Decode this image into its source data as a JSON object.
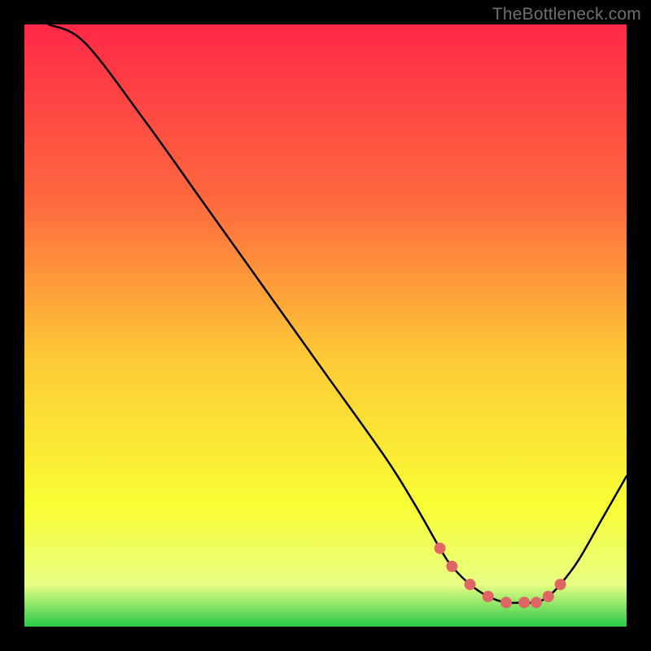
{
  "watermark": "TheBottleneck.com",
  "colors": {
    "gradient_top": "#fe2947",
    "gradient_upper_mid": "#fe6b3e",
    "gradient_mid": "#fdc936",
    "gradient_low": "#f8fe34",
    "gradient_base": "#e8fe83",
    "gradient_green": "#29ca49",
    "curve_stroke": "#000000",
    "dot_fill": "#e06666",
    "frame": "#000000",
    "watermark": "#6f6f6f"
  },
  "chart_data": {
    "type": "line",
    "title": "",
    "xlabel": "",
    "ylabel": "",
    "xlim": [
      0,
      100
    ],
    "ylim": [
      0,
      100
    ],
    "series": [
      {
        "name": "bottleneck-curve",
        "x": [
          4,
          10,
          20,
          30,
          40,
          50,
          60,
          65,
          69,
          71,
          74,
          77,
          80,
          83,
          85,
          87,
          89,
          92,
          96,
          100
        ],
        "values": [
          100,
          97,
          84,
          70,
          56,
          42,
          28,
          20,
          13,
          10,
          7,
          5,
          4,
          4,
          4,
          5,
          7,
          11,
          18,
          25
        ]
      }
    ],
    "dots": {
      "name": "highlighted-points",
      "x": [
        69,
        71,
        74,
        77,
        80,
        83,
        85,
        87,
        89
      ],
      "values": [
        13,
        10,
        7,
        5,
        4,
        4,
        4,
        5,
        7
      ]
    }
  }
}
